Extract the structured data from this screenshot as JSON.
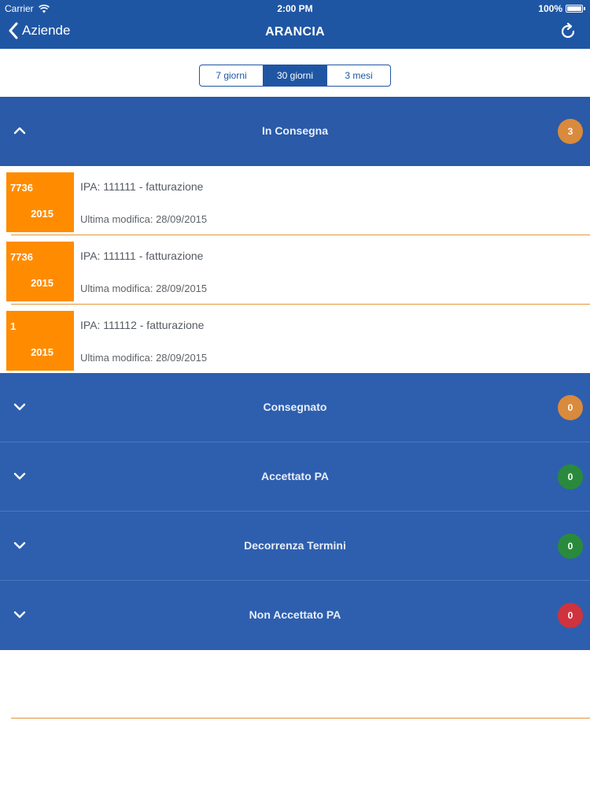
{
  "status_bar": {
    "carrier": "Carrier",
    "time": "2:00 PM",
    "battery": "100%"
  },
  "nav": {
    "back_label": "Aziende",
    "title": "ARANCIA",
    "refresh_icon": "refresh-icon"
  },
  "segments": [
    {
      "label": "7 giorni",
      "active": false
    },
    {
      "label": "30 giorni",
      "active": true
    },
    {
      "label": "3 mesi",
      "active": false
    }
  ],
  "sections": [
    {
      "label": "In Consegna",
      "count": "3",
      "expanded": true,
      "badge_color": "#d98a3c"
    },
    {
      "label": "Consegnato",
      "count": "0",
      "expanded": false,
      "badge_color": "#d98a3c"
    },
    {
      "label": "Accettato PA",
      "count": "0",
      "expanded": false,
      "badge_color": "#2a8a3c"
    },
    {
      "label": "Decorrenza Termini",
      "count": "0",
      "expanded": false,
      "badge_color": "#2a8a3c"
    },
    {
      "label": "Non Accettato PA",
      "count": "0",
      "expanded": false,
      "badge_color": "#d0333d"
    }
  ],
  "in_consegna_items": [
    {
      "number": "7736",
      "year": "2015",
      "ipa": "IPA: 111111 - fatturazione",
      "modified": "Ultima modifica: 28/09/2015"
    },
    {
      "number": "7736",
      "year": "2015",
      "ipa": "IPA: 111111 - fatturazione",
      "modified": "Ultima modifica: 28/09/2015"
    },
    {
      "number": "1",
      "year": "2015",
      "ipa": "IPA: 111112 - fatturazione",
      "modified": "Ultima modifica: 28/09/2015"
    }
  ],
  "colors": {
    "nav_blue": "#1f56a4",
    "section_blue": "#2e5fae",
    "tile_orange": "#ff8c00",
    "separator_orange": "#e0963a"
  }
}
